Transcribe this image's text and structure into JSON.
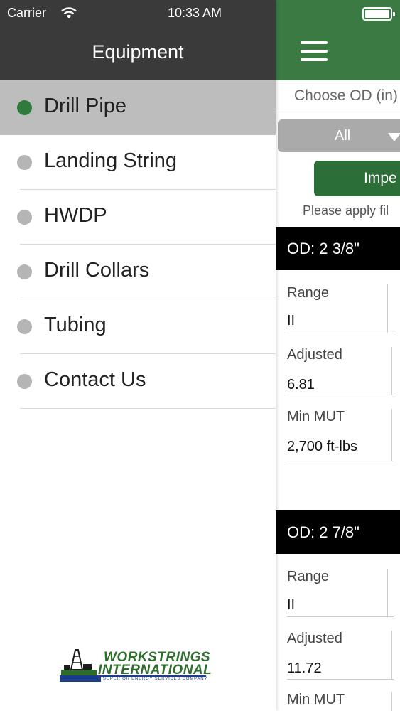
{
  "status_bar": {
    "carrier": "Carrier",
    "time": "10:33 AM"
  },
  "drawer": {
    "title": "Equipment",
    "items": [
      {
        "label": "Drill Pipe",
        "active": true
      },
      {
        "label": "Landing String",
        "active": false
      },
      {
        "label": "HWDP",
        "active": false
      },
      {
        "label": "Drill Collars",
        "active": false
      },
      {
        "label": "Tubing",
        "active": false
      },
      {
        "label": "Contact Us",
        "active": false
      }
    ],
    "logo": {
      "line1": "WORKSTRINGS",
      "line2": "INTERNATIONAL",
      "tagline": "A SUPERIOR ENERGY SERVICES COMPANY"
    }
  },
  "main": {
    "choose_od": "Choose OD (in)",
    "od_select_value": "All",
    "units_button": "Impe",
    "filter_note": "Please apply fil",
    "sections": [
      {
        "header": "OD: 2 3/8\"",
        "fields": [
          {
            "label": "Range",
            "value": "II"
          },
          {
            "label": "Adjusted",
            "value": "6.81"
          },
          {
            "label": "Min MUT",
            "value": "2,700 ft-lbs"
          }
        ]
      },
      {
        "header": "OD: 2 7/8\"",
        "fields": [
          {
            "label": "Range",
            "value": "II"
          },
          {
            "label": "Adjusted",
            "value": "11.72"
          },
          {
            "label": "Min MUT",
            "value": ""
          }
        ]
      }
    ]
  },
  "colors": {
    "brand_green": "#3c7a44",
    "active_dot": "#2f7a3c",
    "header_dark": "#3a3a3a",
    "active_row": "#bdbdbd"
  }
}
